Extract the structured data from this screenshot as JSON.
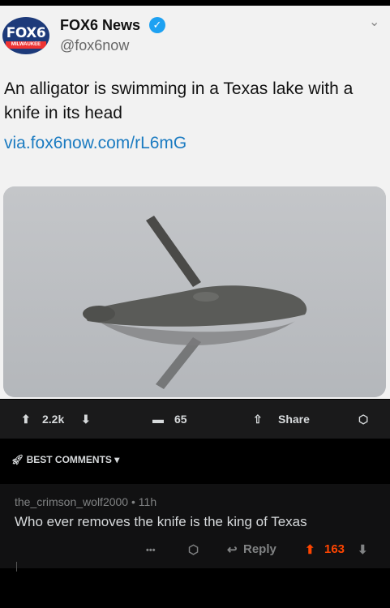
{
  "tweet": {
    "logo_text": "FOX6",
    "logo_sub": "MILWAUKEE",
    "name": "FOX6 News",
    "handle": "@fox6now",
    "text": "An alligator is swimming in a Texas lake with a knife in its head",
    "link": "via.fox6now.com/rL6mG"
  },
  "post_actions": {
    "votes": "2.2k",
    "comments": "65",
    "share": "Share"
  },
  "sort": {
    "label": "BEST COMMENTS"
  },
  "comment": {
    "author": "the_crimson_wolf2000",
    "age": "11h",
    "text": "Who ever removes the knife is the king of Texas",
    "more": "•••",
    "reply": "Reply",
    "score": "163"
  },
  "colors": {
    "upvote": "#ff4500",
    "link": "#1b7bc1",
    "verified": "#1da1f2"
  }
}
